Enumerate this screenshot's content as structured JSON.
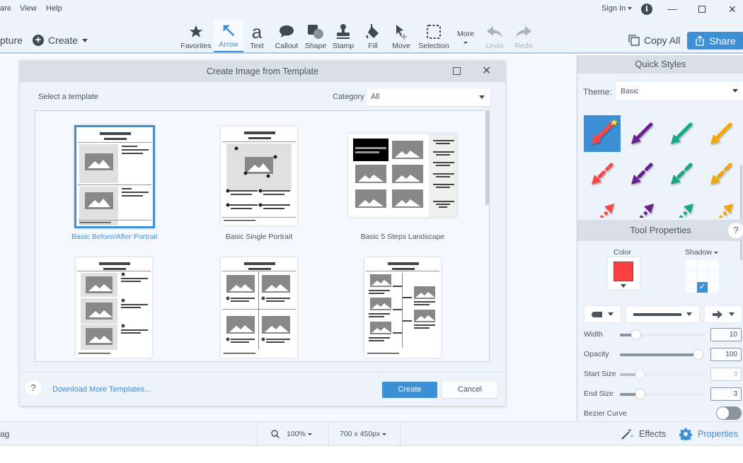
{
  "menu": {
    "items": [
      "are",
      "View",
      "Help"
    ]
  },
  "left_actions": {
    "capture": "pture",
    "create": "Create"
  },
  "toolbar": {
    "tools": [
      {
        "label": "Favorites",
        "icon": "star-icon"
      },
      {
        "label": "Arrow",
        "icon": "arrow-icon",
        "active": true
      },
      {
        "label": "Text",
        "icon": "text-icon"
      },
      {
        "label": "Callout",
        "icon": "callout-icon"
      },
      {
        "label": "Shape",
        "icon": "shape-icon"
      },
      {
        "label": "Stamp",
        "icon": "stamp-icon"
      },
      {
        "label": "Fill",
        "icon": "fill-icon"
      },
      {
        "label": "Move",
        "icon": "move-icon"
      },
      {
        "label": "Selection",
        "icon": "selection-icon"
      }
    ],
    "more": "More",
    "undo": "Undo",
    "redo": "Redo"
  },
  "window": {
    "sign_in": "Sign In",
    "info": "i"
  },
  "actions": {
    "copy_all": "Copy All",
    "share": "Share"
  },
  "dialog": {
    "title": "Create Image from Template",
    "select_label": "Select a template",
    "category_label": "Category",
    "category_value": "All",
    "templates": [
      {
        "name": "Basic Before/After Portrait",
        "selected": true
      },
      {
        "name": "Basic Single Portrait"
      },
      {
        "name": "Basic 5 Steps Landscape"
      },
      {
        "name": ""
      },
      {
        "name": ""
      },
      {
        "name": ""
      }
    ],
    "help": "?",
    "download_link": "Download More Templates...",
    "create": "Create",
    "cancel": "Cancel"
  },
  "quick_styles": {
    "title": "Quick Styles",
    "theme_label": "Theme:",
    "theme_value": "Basic",
    "colors": [
      "#ff4646",
      "#6a2190",
      "#13a88a",
      "#f5a700"
    ]
  },
  "tool_properties": {
    "title": "Tool Properties",
    "help": "?",
    "color_label": "Color",
    "color_value": "#ff3f40",
    "shadow_label": "Shadow",
    "shadow_selected_cell": 7,
    "width_label": "Width",
    "width_value": "10",
    "width_fraction": 0.2,
    "opacity_label": "Opacity",
    "opacity_value": "100",
    "opacity_fraction": 1.0,
    "start_size_label": "Start Size",
    "start_size_value": "3",
    "start_size_fraction": 0.25,
    "end_size_label": "End Size",
    "end_size_value": "3",
    "end_size_fraction": 0.25,
    "bezier_label": "Bezier Curve",
    "bezier_on": false
  },
  "status": {
    "left_text": "ag",
    "zoom": "100%",
    "size": "700 x 450px",
    "effects": "Effects",
    "properties": "Properties"
  }
}
